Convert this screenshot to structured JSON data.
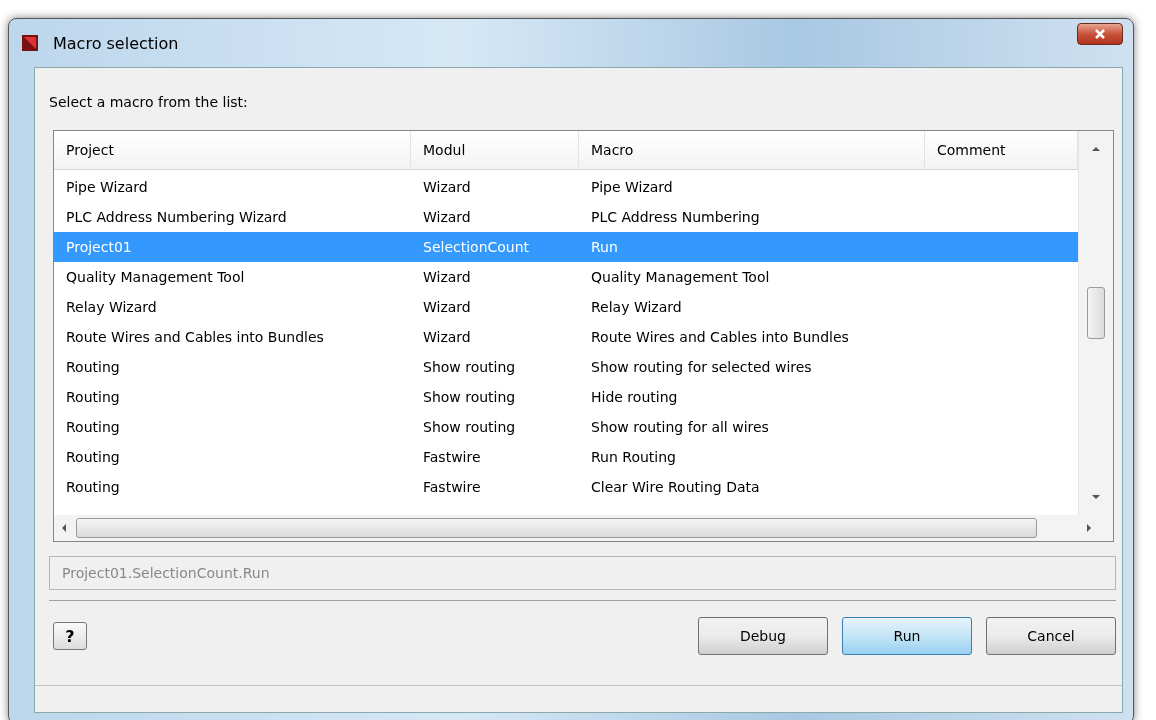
{
  "window": {
    "title": "Macro selection"
  },
  "prompt": "Select a macro from the list:",
  "table": {
    "columns": [
      "Project",
      "Modul",
      "Macro",
      "Comment"
    ],
    "rows": [
      {
        "cells": [
          "Pipe Wizard",
          "Wizard",
          "Pipe Wizard"
        ],
        "selected": false
      },
      {
        "cells": [
          "PLC Address Numbering Wizard",
          "Wizard",
          "PLC Address Numbering"
        ],
        "selected": false
      },
      {
        "cells": [
          "Project01",
          "SelectionCount",
          "Run"
        ],
        "selected": true
      },
      {
        "cells": [
          "Quality Management Tool",
          "Wizard",
          "Quality Management Tool"
        ],
        "selected": false
      },
      {
        "cells": [
          "Relay Wizard",
          "Wizard",
          "Relay Wizard"
        ],
        "selected": false
      },
      {
        "cells": [
          "Route Wires and Cables into Bundles",
          "Wizard",
          "Route Wires and Cables into Bundles"
        ],
        "selected": false
      },
      {
        "cells": [
          "Routing",
          "Show routing",
          "Show routing for selected wires"
        ],
        "selected": false
      },
      {
        "cells": [
          "Routing",
          "Show routing",
          "Hide routing"
        ],
        "selected": false
      },
      {
        "cells": [
          "Routing",
          "Show routing",
          "Show routing for all wires"
        ],
        "selected": false
      },
      {
        "cells": [
          "Routing",
          "Fastwire",
          "Run Routing"
        ],
        "selected": false
      },
      {
        "cells": [
          "Routing",
          "Fastwire",
          "Clear Wire Routing Data"
        ],
        "selected": false
      }
    ]
  },
  "path_field": {
    "value": "Project01.SelectionCount.Run"
  },
  "help_button": {
    "label": "?"
  },
  "buttons": [
    {
      "label": "Debug",
      "focused": false
    },
    {
      "label": "Run",
      "focused": true
    },
    {
      "label": "Cancel",
      "focused": false
    }
  ]
}
